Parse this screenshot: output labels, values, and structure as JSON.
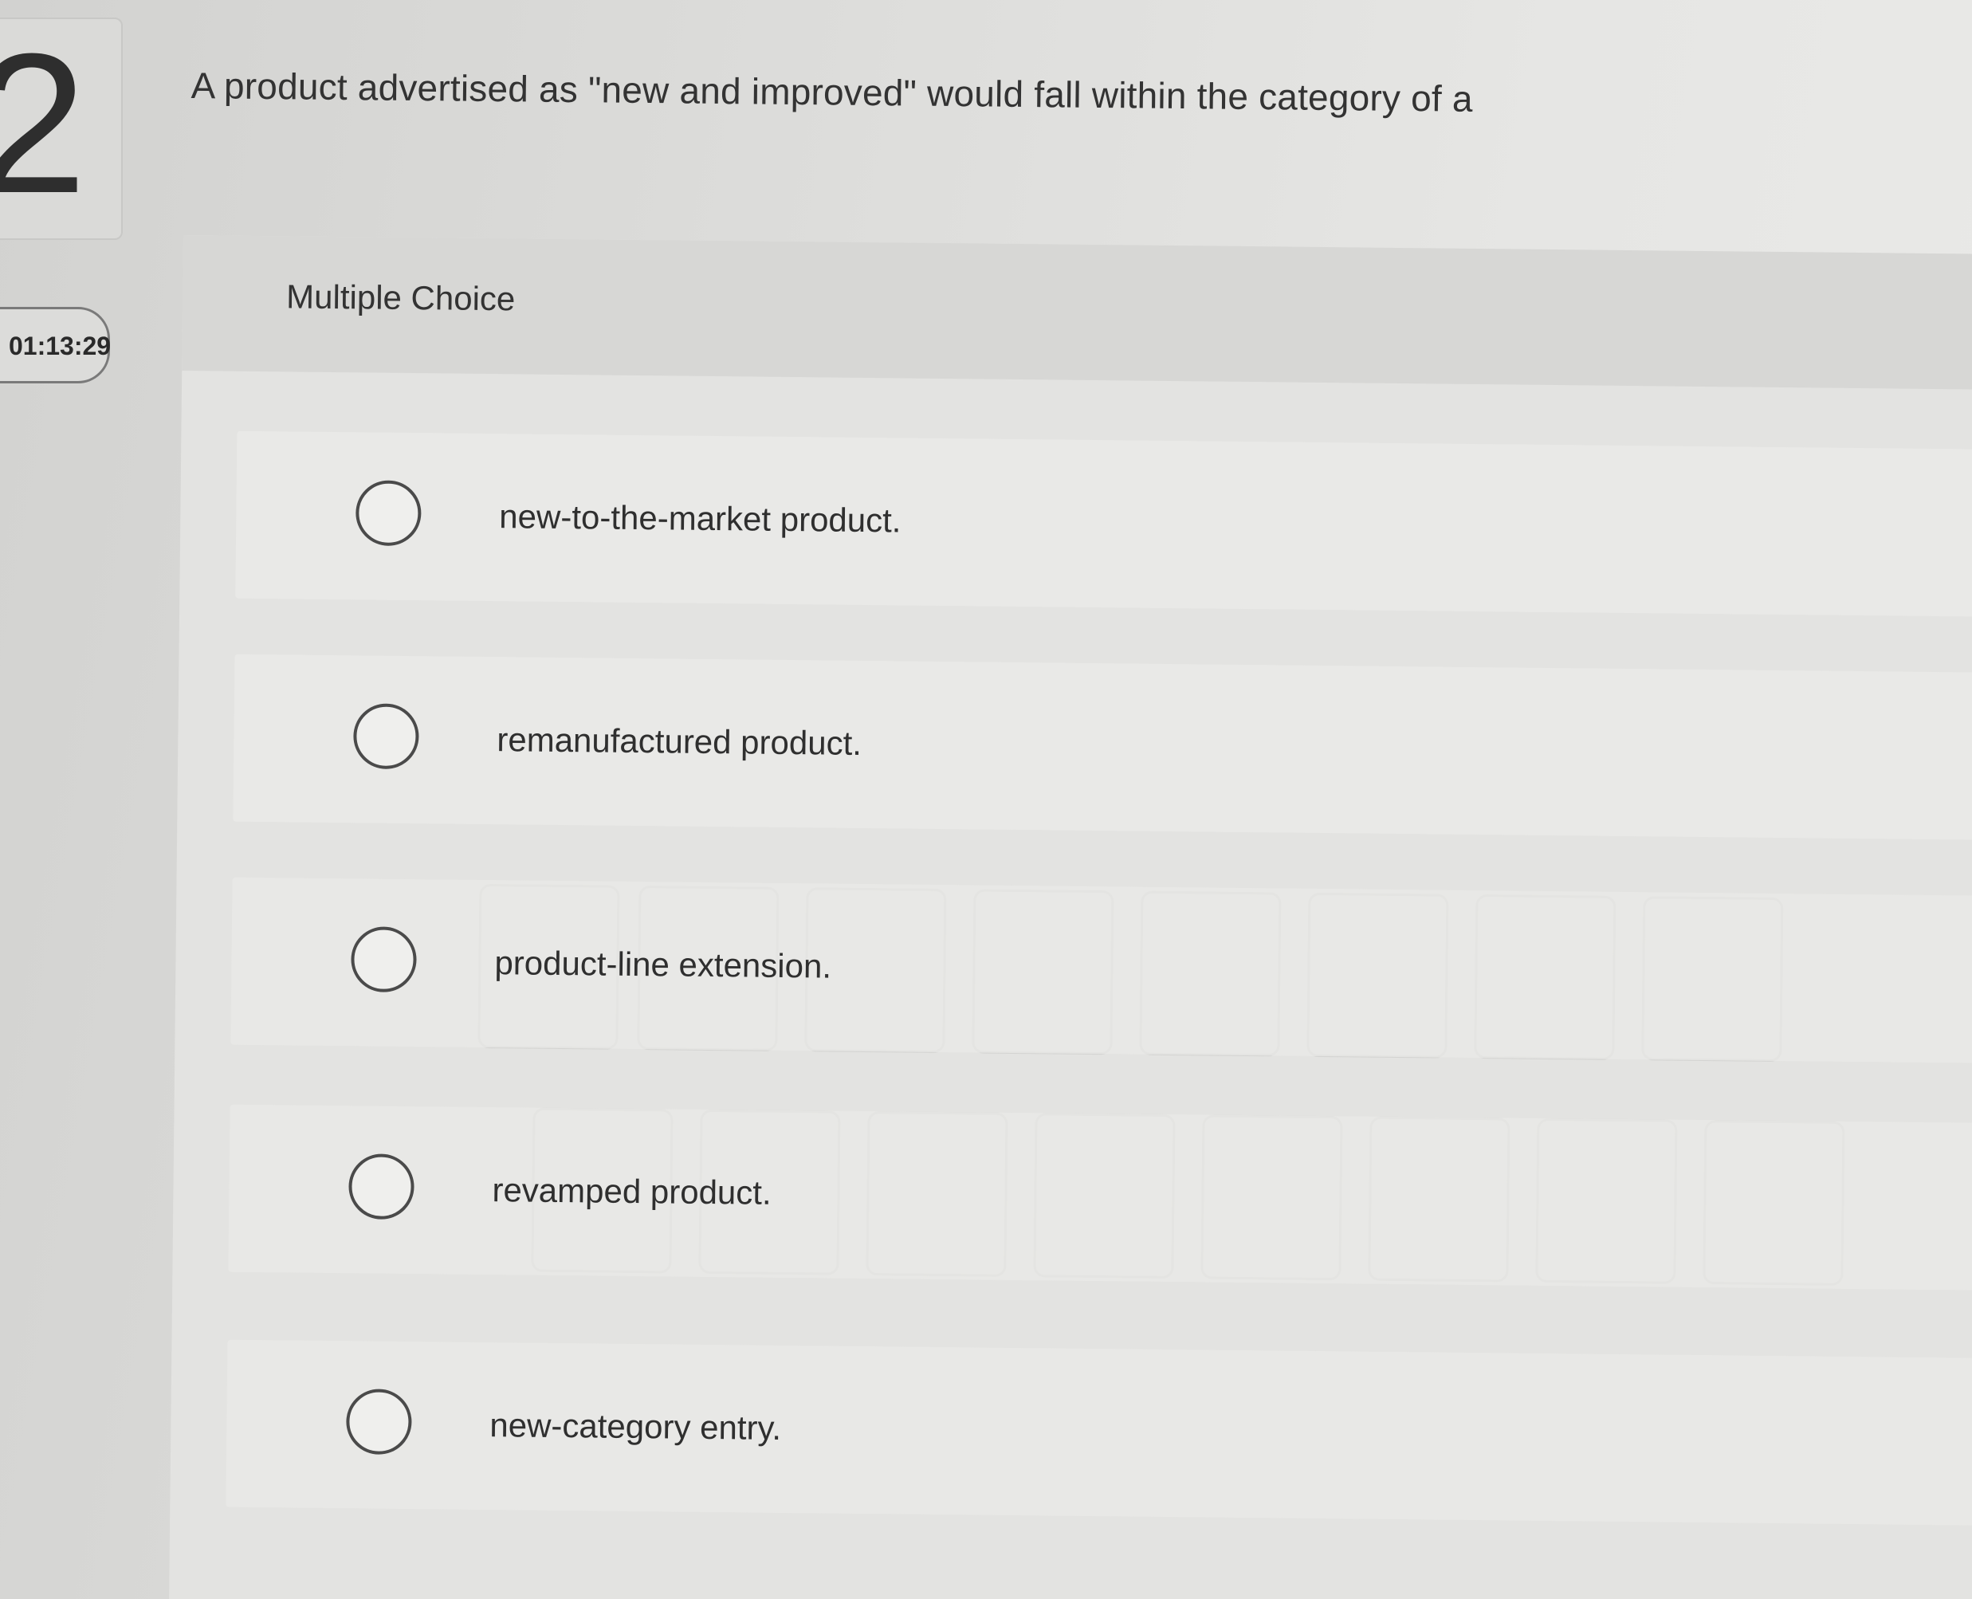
{
  "question_number": "2",
  "timer": "01:13:29",
  "question_text": "A product advertised as \"new and improved\" would fall within the category of a",
  "answer_type_label": "Multiple Choice",
  "choices": [
    {
      "label": "new-to-the-market product.",
      "selected": false
    },
    {
      "label": "remanufactured product.",
      "selected": false
    },
    {
      "label": "product-line extension.",
      "selected": false
    },
    {
      "label": "revamped product.",
      "selected": false
    },
    {
      "label": "new-category entry.",
      "selected": false
    }
  ],
  "icons": {
    "radio": "radio-unselected-icon"
  },
  "colors": {
    "background": "#dcdcda",
    "panel": "#e3e3e1",
    "text": "#333333",
    "radio_border": "#4a4a4a"
  }
}
